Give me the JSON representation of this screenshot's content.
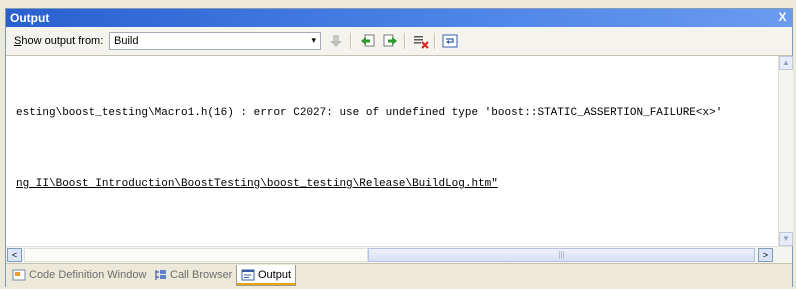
{
  "window": {
    "title": "Output",
    "close_glyph": "X"
  },
  "toolbar": {
    "show_output_label_first": "S",
    "show_output_label_rest": "how output from:",
    "source_value": "Build",
    "dropdown_glyph": "▾",
    "buttons": [
      {
        "name": "find-message-in-code-button",
        "icon": "arrow-down-icon"
      },
      {
        "name": "go-to-previous-message-button",
        "icon": "back-arrow-icon"
      },
      {
        "name": "go-to-next-message-button",
        "icon": "forward-arrow-icon"
      },
      {
        "name": "clear-all-button",
        "icon": "clear-all-icon"
      },
      {
        "name": "toggle-word-wrap-button",
        "icon": "word-wrap-icon"
      }
    ]
  },
  "output": {
    "lines": [
      "esting\\boost_testing\\Macro1.h(16) : error C2027: use of undefined type 'boost::STATIC_ASSERTION_FAILURE<x>'",
      "ng II\\Boost Introduction\\BoostTesting\\boost_testing\\Release\\BuildLog.htm\""
    ]
  },
  "scrollbars": {
    "up_glyph": "▲",
    "down_glyph": "▼",
    "left_glyph": "<",
    "right_glyph": ">",
    "grip_glyph": "|||"
  },
  "tabs": [
    {
      "label": "Code Definition Window",
      "icon": "code-definition-icon",
      "active": false
    },
    {
      "label": "Call Browser",
      "icon": "call-browser-icon",
      "active": false
    },
    {
      "label": "Output",
      "icon": "output-icon",
      "active": true
    }
  ]
}
